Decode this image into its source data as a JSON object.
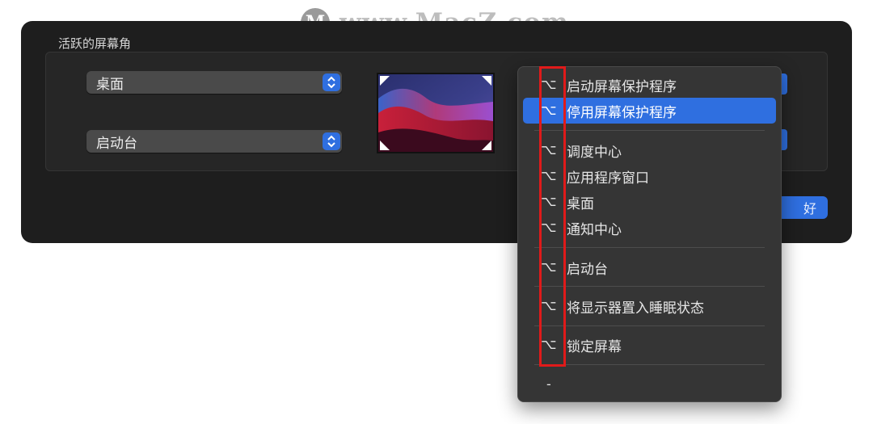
{
  "watermark": {
    "logo_letter": "M",
    "text": "www.MacZ.com"
  },
  "dialog": {
    "group_title": "活跃的屏幕角",
    "corner_top_left": "桌面",
    "corner_bottom_left": "启动台",
    "ok_partial": "好"
  },
  "menu": {
    "modifier_symbol": "⌥",
    "items": [
      {
        "label": "启动屏幕保护程序",
        "selected": false
      },
      {
        "label": "停用屏幕保护程序",
        "selected": true
      },
      {
        "label": "调度中心",
        "selected": false
      },
      {
        "label": "应用程序窗口",
        "selected": false
      },
      {
        "label": "桌面",
        "selected": false
      },
      {
        "label": "通知中心",
        "selected": false
      },
      {
        "label": "启动台",
        "selected": false
      },
      {
        "label": "将显示器置入睡眠状态",
        "selected": false
      },
      {
        "label": "锁定屏幕",
        "selected": false
      }
    ],
    "none_item": "-"
  },
  "colors": {
    "accent": "#2f6fe0",
    "highlight_box": "#e01a1a",
    "panel_bg": "#1e1e1e",
    "menu_bg": "#353535"
  }
}
